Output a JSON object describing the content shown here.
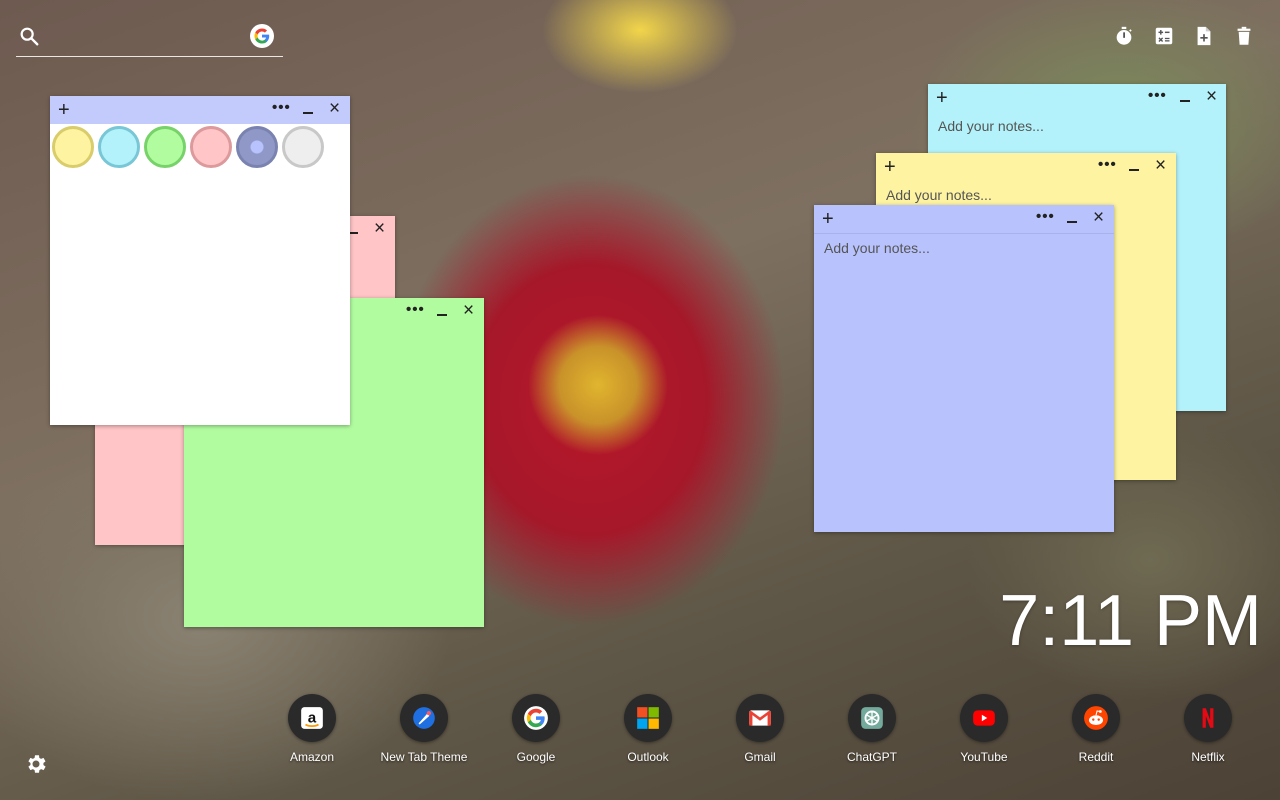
{
  "search": {
    "placeholder": "",
    "engine_icon": "google-g-icon"
  },
  "toolbar": {
    "icons": [
      "timer-icon",
      "calculator-icon",
      "add-note-icon",
      "trash-icon"
    ]
  },
  "notes": [
    {
      "name": "note-blue",
      "color": "#b3f2fb",
      "placeholder": "Add your notes..."
    },
    {
      "name": "note-yellow",
      "color": "#fdf3a1",
      "placeholder": "Add your notes..."
    },
    {
      "name": "note-periwinkle",
      "color": "#b8c3fd",
      "placeholder": "Add your notes..."
    },
    {
      "name": "note-pink",
      "color": "#ffc5c7",
      "placeholder": ""
    },
    {
      "name": "note-green",
      "color": "#b2fca0",
      "placeholder": ""
    },
    {
      "name": "note-white",
      "color": "#ffffff",
      "placeholder": ""
    }
  ],
  "note_controls": {
    "add": "+",
    "more": "•••",
    "close": "×"
  },
  "color_swatches": [
    {
      "fill": "#fdf3a1",
      "border": "#d9cc6a"
    },
    {
      "fill": "#b3f2fb",
      "border": "#79c7d6"
    },
    {
      "fill": "#b2fca0",
      "border": "#78d26a"
    },
    {
      "fill": "#ffc5c7",
      "border": "#dc9a9d"
    },
    {
      "fill": "#8f98c6",
      "border": "#7a83b0",
      "selected": true
    },
    {
      "fill": "#eeeeee",
      "border": "#c8c8c8"
    }
  ],
  "clock": {
    "time": "7:11 PM"
  },
  "dock": [
    {
      "label": "Amazon",
      "icon": "amazon-icon"
    },
    {
      "label": "New Tab Theme",
      "icon": "new-tab-theme-icon"
    },
    {
      "label": "Google",
      "icon": "google-icon"
    },
    {
      "label": "Outlook",
      "icon": "outlook-icon"
    },
    {
      "label": "Gmail",
      "icon": "gmail-icon"
    },
    {
      "label": "ChatGPT",
      "icon": "chatgpt-icon"
    },
    {
      "label": "YouTube",
      "icon": "youtube-icon"
    },
    {
      "label": "Reddit",
      "icon": "reddit-icon"
    },
    {
      "label": "Netflix",
      "icon": "netflix-icon"
    }
  ],
  "settings": {
    "icon": "gear-icon"
  }
}
